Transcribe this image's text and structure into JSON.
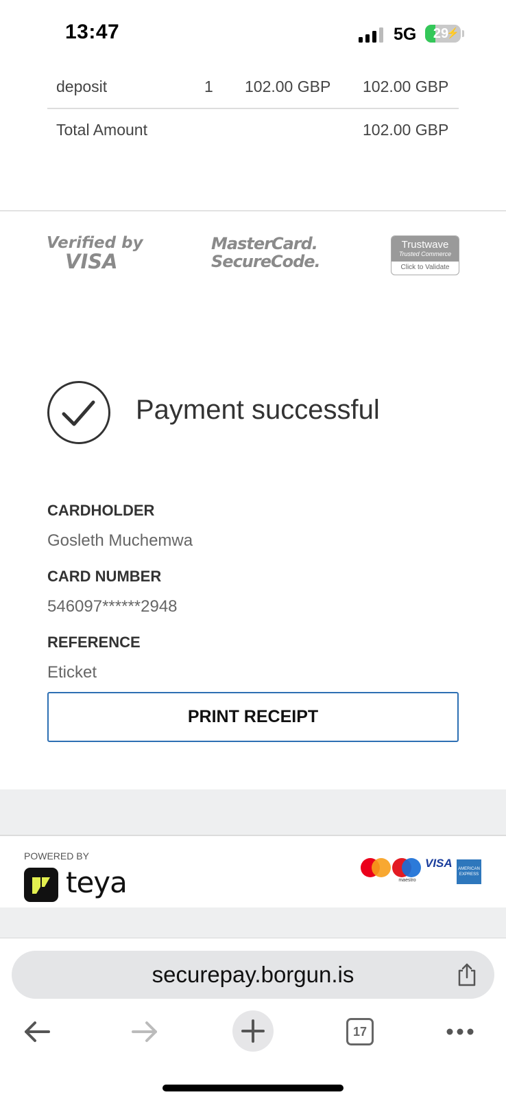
{
  "status_bar": {
    "time": "13:47",
    "network": "5G",
    "battery": "29"
  },
  "order": {
    "row": {
      "item": "deposit",
      "qty": "1",
      "unit_price": "102.00 GBP",
      "total": "102.00 GBP"
    },
    "total_label": "Total Amount",
    "total_value": "102.00 GBP"
  },
  "security_logos": {
    "visa_line1": "Verified by",
    "visa_line2": "VISA",
    "mc_line1": "MasterCard.",
    "mc_line2": "SecureCode.",
    "trustwave_line1": "Trustwave",
    "trustwave_line2": "Trusted Commerce",
    "trustwave_line3": "Click to Validate"
  },
  "result": {
    "message": "Payment successful",
    "cardholder_label": "CARDHOLDER",
    "cardholder_value": "Gosleth Muchemwa",
    "card_number_label": "CARD NUMBER",
    "card_number_value": "546097******2948",
    "reference_label": "REFERENCE",
    "reference_value": "Eticket",
    "print_button": "PRINT RECEIPT"
  },
  "footer": {
    "powered_by": "POWERED BY",
    "brand": "teya",
    "maestro_label": "maestro",
    "visa_label": "VISA",
    "amex_label": "AMERICAN EXPRESS"
  },
  "browser": {
    "url": "securepay.borgun.is",
    "tab_count": "17",
    "icons": [
      "back-arrow-icon",
      "forward-arrow-icon",
      "new-tab-plus-icon",
      "tabs-icon",
      "more-icon",
      "share-icon"
    ]
  }
}
